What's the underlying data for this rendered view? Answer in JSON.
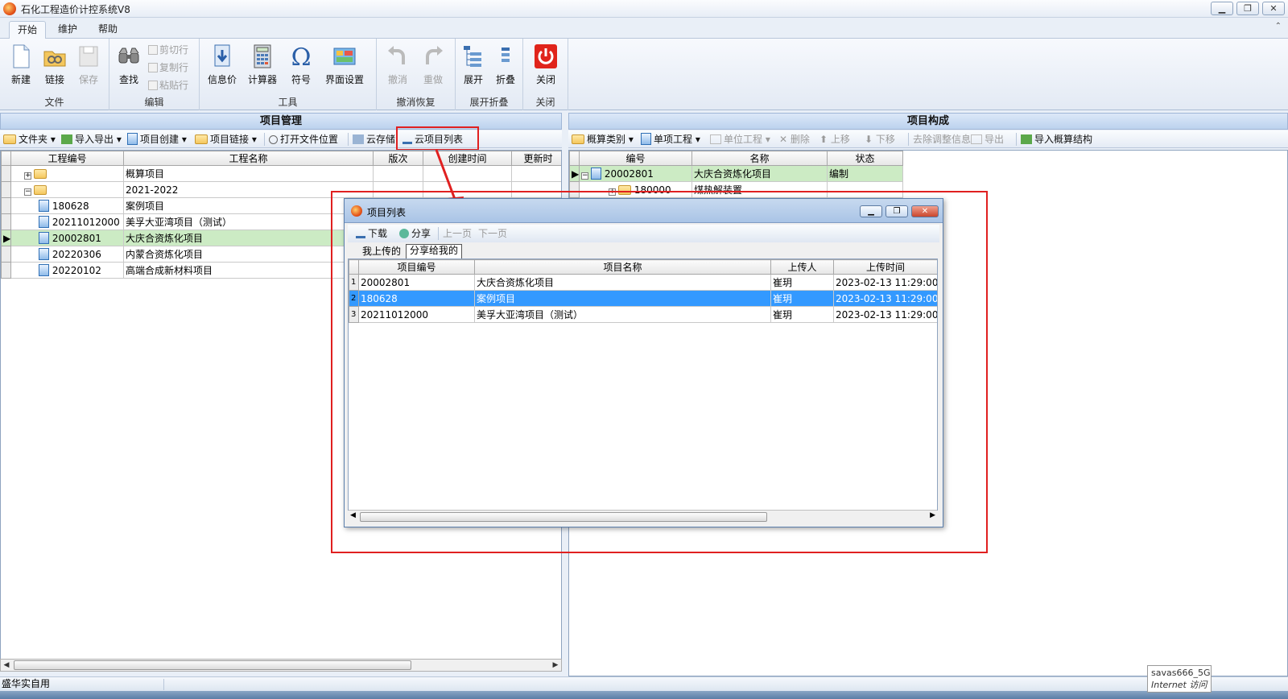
{
  "window": {
    "title": "石化工程造价计控系统V8",
    "btn_min": "▁",
    "btn_max": "❐",
    "btn_close": "✕"
  },
  "ribbon": {
    "tabs": [
      "开始",
      "维护",
      "帮助"
    ],
    "collapse_glyph": "⌃",
    "groups": {
      "file": {
        "label": "文件",
        "new": "新建",
        "link": "链接",
        "save": "保存"
      },
      "edit": {
        "label": "编辑",
        "find": "查找",
        "cut": "剪切行",
        "copy": "复制行",
        "paste": "粘贴行"
      },
      "tools": {
        "label": "工具",
        "info_price": "信息价",
        "calculator": "计算器",
        "symbol": "符号",
        "ui_settings": "界面设置"
      },
      "undo": {
        "label": "撤消恢复",
        "undo": "撤消",
        "redo": "重做"
      },
      "expand": {
        "label": "展开折叠",
        "expand": "展开",
        "collapse": "折叠"
      },
      "close": {
        "label": "关闭",
        "close": "关闭"
      }
    }
  },
  "left_panel": {
    "header": "项目管理",
    "toolbar": {
      "folder": "文件夹",
      "import_export": "导入导出",
      "project_create": "项目创建",
      "project_link": "项目链接",
      "open_location": "打开文件位置",
      "cloud_save": "云存储",
      "cloud_list": "云项目列表"
    },
    "columns": [
      "工程编号",
      "工程名称",
      "版次",
      "创建时间",
      "更新时"
    ],
    "rows": [
      {
        "code": "",
        "name": "概算项目",
        "level": 0,
        "type": "folder",
        "expander": "+"
      },
      {
        "code": "",
        "name": "2021-2022",
        "level": 0,
        "type": "folder",
        "expander": "−"
      },
      {
        "code": "180628",
        "name": "案例项目",
        "level": 1,
        "type": "doc"
      },
      {
        "code": "20211012000",
        "name": "美孚大亚湾项目（测试）",
        "level": 1,
        "type": "doc"
      },
      {
        "code": "20002801",
        "name": "大庆合资炼化项目",
        "level": 1,
        "type": "doc",
        "selected": true
      },
      {
        "code": "20220306",
        "name": "内蒙合资炼化项目",
        "level": 1,
        "type": "doc"
      },
      {
        "code": "20220102",
        "name": "高端合成新材料项目",
        "level": 1,
        "type": "doc"
      }
    ]
  },
  "right_panel": {
    "header": "项目构成",
    "toolbar": {
      "estimate_type": "概算类别",
      "single_project": "单项工程",
      "unit_project": "单位工程",
      "delete": "删除",
      "move_up": "上移",
      "move_down": "下移",
      "remove_adjust": "去除调整信息",
      "export": "导出",
      "import_structure": "导入概算结构"
    },
    "columns": [
      "编号",
      "名称",
      "状态"
    ],
    "rows": [
      {
        "code": "20002801",
        "name": "大庆合资炼化项目",
        "status": "编制"
      },
      {
        "code": "180000",
        "name": "煤热解装置",
        "status": ""
      }
    ]
  },
  "dialog": {
    "title": "项目列表",
    "toolbar": {
      "download": "下载",
      "share": "分享",
      "prev": "上一页",
      "next": "下一页"
    },
    "tabs": [
      "我上传的",
      "分享给我的"
    ],
    "columns": [
      "项目编号",
      "项目名称",
      "上传人",
      "上传时间"
    ],
    "rows": [
      {
        "idx": "1",
        "code": "20002801",
        "name": "大庆合资炼化项目",
        "uploader": "崔玥",
        "time": "2023-02-13 11:29:00"
      },
      {
        "idx": "2",
        "code": "180628",
        "name": "案例项目",
        "uploader": "崔玥",
        "time": "2023-02-13 11:29:00",
        "selected": true
      },
      {
        "idx": "3",
        "code": "20211012000",
        "name": "美孚大亚湾项目（测试）",
        "uploader": "崔玥",
        "time": "2023-02-13 11:29:00"
      }
    ]
  },
  "status": {
    "user": "盛华实自用"
  },
  "tooltip": {
    "line1": "savas666_5G",
    "line2": "Internet 访问"
  },
  "colors": {
    "selected_green": "#ccebc4",
    "selected_blue": "#3399ff",
    "highlight_red": "#e02020"
  }
}
